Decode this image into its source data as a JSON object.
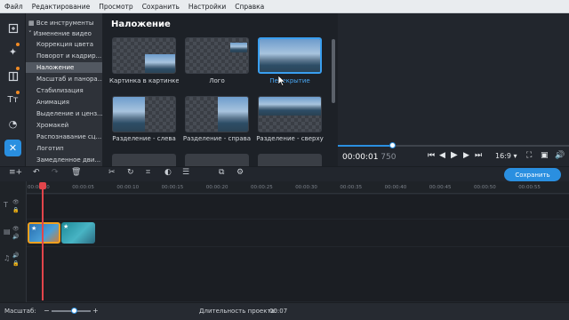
{
  "menu": [
    "Файл",
    "Редактирование",
    "Просмотр",
    "Сохранить",
    "Настройки",
    "Справка"
  ],
  "icons": {
    "rail": [
      "import-icon",
      "magic-wand-icon",
      "filters-icon",
      "titles-icon",
      "stickers-icon",
      "tools-icon"
    ],
    "player": [
      "skip-back-icon",
      "step-back-icon",
      "play-icon",
      "step-forward-icon",
      "skip-forward-icon",
      "volume-icon"
    ],
    "toolbar": [
      "undo-icon",
      "redo-icon",
      "delete-icon",
      "cut-icon",
      "rotate-icon",
      "crop-icon",
      "color-icon",
      "properties-icon",
      "overlay-icon",
      "settings-icon"
    ]
  },
  "categories": [
    {
      "label": "Все инструменты",
      "type": "head"
    },
    {
      "label": "Изменение видео",
      "type": "head"
    },
    {
      "label": "Коррекция цвета",
      "type": "sub"
    },
    {
      "label": "Поворот и кадрир...",
      "type": "sub"
    },
    {
      "label": "Наложение",
      "type": "sub",
      "selected": true
    },
    {
      "label": "Масштаб и панора...",
      "type": "sub"
    },
    {
      "label": "Стабилизация",
      "type": "sub"
    },
    {
      "label": "Анимация",
      "type": "sub"
    },
    {
      "label": "Выделение и ценз...",
      "type": "sub"
    },
    {
      "label": "Хромакей",
      "type": "sub"
    },
    {
      "label": "Распознавание сц...",
      "type": "sub"
    },
    {
      "label": "Логотип",
      "type": "sub"
    },
    {
      "label": "Замедленное дви...",
      "type": "sub"
    }
  ],
  "panel": {
    "title": "Наложение",
    "thumbnails": [
      {
        "label": "Картинка в картинке"
      },
      {
        "label": "Лого"
      },
      {
        "label": "Перекрытие",
        "selected": true
      },
      {
        "label": "Разделение - слева"
      },
      {
        "label": "Разделение - справа"
      },
      {
        "label": "Разделение - сверху"
      }
    ]
  },
  "player": {
    "progress": 0.24,
    "time_main": "00:00:01",
    "time_frames": "750",
    "aspect": "16:9 ▾"
  },
  "toolbar": {
    "save_label": "Сохранить"
  },
  "ruler": [
    "00:00:00",
    "00:00:05",
    "00:00:10",
    "00:00:15",
    "00:00:20",
    "00:00:25",
    "00:00:30",
    "00:00:35",
    "00:00:40",
    "00:00:45",
    "00:00:50",
    "00:00:55"
  ],
  "status": {
    "scale_label": "Масштаб:",
    "zoom": 0.6,
    "duration_label": "Длительность проекта:",
    "duration_value": "00:07"
  },
  "colors": {
    "accent": "#2a8fe0",
    "playhead": "#e2454b",
    "clip_selected": "#f0a020"
  }
}
